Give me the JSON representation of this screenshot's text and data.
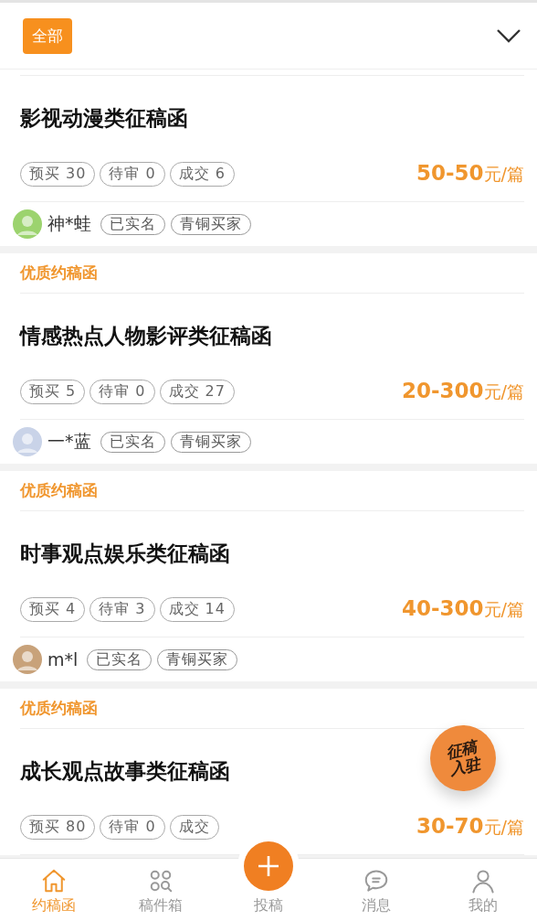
{
  "filter": {
    "chip": "全部",
    "selected": true
  },
  "cards": [
    {
      "title": "影视动漫类征稿函",
      "stats": [
        "预买 30",
        "待审 0",
        "成交 6"
      ],
      "price": "**50-50**元/篇",
      "user": {
        "name": "神*蛙",
        "badges": [
          "已实名",
          "青铜买家"
        ]
      }
    },
    {
      "tag": "优质约稿函",
      "title": "情感热点人物影评类征稿函",
      "stats": [
        "预买 5",
        "待审 0",
        "成交 27"
      ],
      "price": "**20-300**元/篇",
      "user": {
        "name": "一*蓝",
        "badges": [
          "已实名",
          "青铜买家"
        ]
      }
    },
    {
      "tag": "优质约稿函",
      "title": "时事观点娱乐类征稿函",
      "stats": [
        "预买 4",
        "待审 3",
        "成交 14"
      ],
      "price": "**40-300**元/篇",
      "user": {
        "name": "m*l",
        "badges": [
          "已实名",
          "青铜买家"
        ]
      }
    },
    {
      "tag": "优质约稿函",
      "title": "成长观点故事类征稿函",
      "stats": [
        "预买 80",
        "待审 0",
        "成交"
      ],
      "price": "**30-70**元/篇"
    }
  ],
  "floating_badge": "征稿入驻",
  "nav": [
    {
      "kind": "home",
      "label": "约稿函",
      "selected": true
    },
    {
      "kind": "box",
      "label": "稿件箱",
      "selected": false
    },
    {
      "kind": "post",
      "label": "投稿",
      "selected": false
    },
    {
      "kind": "message",
      "label": "消息",
      "selected": false
    },
    {
      "kind": "me",
      "label": "我的",
      "selected": false
    }
  ]
}
